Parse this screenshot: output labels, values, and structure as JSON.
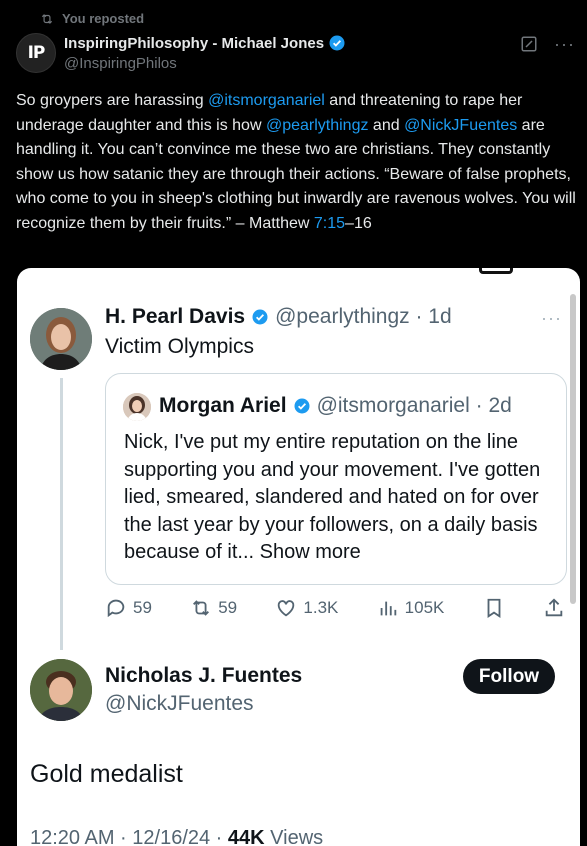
{
  "repost": {
    "label": "You reposted"
  },
  "post": {
    "author_name": "InspiringPhilosophy - Michael Jones",
    "author_handle": "@InspiringPhilos",
    "avatar_initials": "IP",
    "text_parts": {
      "p1": "So groypers are harassing ",
      "m1": "@itsmorganariel",
      "p2": " and threatening to rape her underage daughter and this is how ",
      "m2": "@pearlythingz",
      "p3": " and ",
      "m3": "@NickJFuentes",
      "p4": " are handling it. You can’t convince me these two are christians. They constantly show us how satanic they are through their actions. “Beware of false prophets, who come to you in sheep's clothing but inwardly are ravenous wolves. You will recognize them by their fruits.” – Matthew ",
      "verse_link": "7:15",
      "p5": "–16"
    }
  },
  "embedded": {
    "pearl": {
      "name": "H. Pearl Davis",
      "handle_time": "@pearlythingz · 1d",
      "text": "Victim Olympics"
    },
    "quote": {
      "name": "Morgan Ariel",
      "handle_time": "@itsmorganariel · 2d",
      "text": "Nick, I've put my entire reputation on the line supporting you and your movement. I've gotten lied, smeared, slandered and hated on for over the last year by your followers, on a daily basis because of it...",
      "show_more": "Show more"
    },
    "actions": {
      "replies": "59",
      "reposts": "59",
      "likes": "1.3K",
      "views": "105K"
    },
    "nick": {
      "name": "Nicholas J. Fuentes",
      "handle": "@NickJFuentes",
      "follow_label": "Follow",
      "text": "Gold medalist",
      "timestamp": "12:20 AM · 12/16/24 · ",
      "views_count": "44K",
      "views_label": "Views"
    }
  },
  "colors": {
    "accent": "#1d9bf0",
    "background": "#000000",
    "card": "#ffffff"
  }
}
